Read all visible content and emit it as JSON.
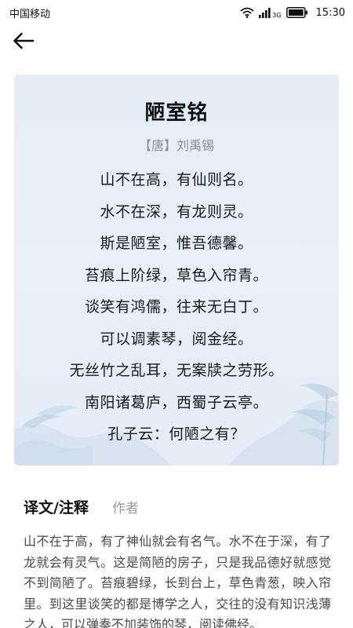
{
  "status_bar": {
    "carrier": "中国移动",
    "network": "3G",
    "time": "15:30"
  },
  "nav": {
    "back_icon": "arrow-left-icon"
  },
  "poem": {
    "title": "陋室铭",
    "author": "【唐】刘禹锡",
    "lines": [
      "山不在高，有仙则名。",
      "水不在深，有龙则灵。",
      "斯是陋室，惟吾德馨。",
      "苔痕上阶绿，草色入帘青。",
      "谈笑有鸿儒，往来无白丁。",
      "可以调素琴，阅金经。",
      "无丝竹之乱耳，无案牍之劳形。",
      "南阳诸葛庐，西蜀子云亭。",
      "孔子云：何陋之有？"
    ]
  },
  "tabs": {
    "translation": "译文/注释",
    "author": "作者"
  },
  "translation": {
    "text": "山不在于高，有了神仙就会有名气。水不在于深，有了龙就会有灵气。这是简陋的房子，只是我品德好就感觉不到简陋了。苔痕碧绿，长到台上，草色青葱，映入帘里。到这里谈笑的都是博学之人，交往的没有知识浅薄之人，可以弹奏不加装饰的琴，阅读佛经。"
  },
  "colors": {
    "card_background": "#e6eef9",
    "title": "#111111",
    "author": "#8a8f96",
    "tab_inactive": "#9a9a9a",
    "body_text": "#4a4a4a"
  }
}
